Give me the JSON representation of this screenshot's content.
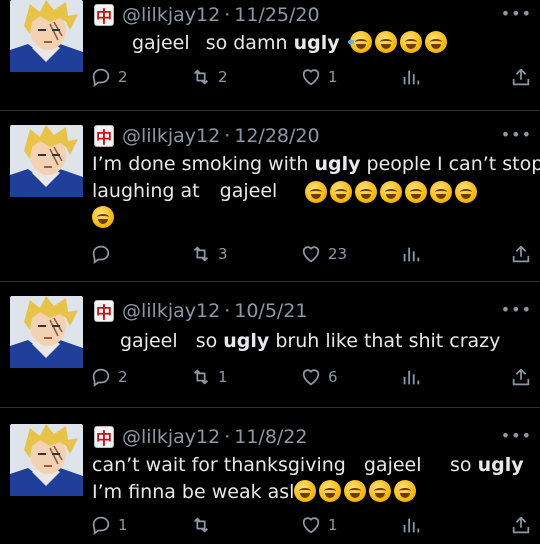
{
  "tweets": [
    {
      "handle": "@lilkjay12",
      "separator": "·",
      "date": "11/25/20",
      "more": "•••",
      "lines": [
        {
          "parts": [
            "gajeel",
            "so damn",
            "ugly"
          ],
          "emoji_count": 4
        }
      ],
      "replies": "2",
      "retweets": "2",
      "likes": "1"
    },
    {
      "handle": "@lilkjay12",
      "separator": "·",
      "date": "12/28/20",
      "more": "•••",
      "line1_pre": "I’m done smoking with ",
      "line1_bold": "ugly",
      "line1_post": " people I can’t stop",
      "line2": "laughing at",
      "line2_name": "gajeel",
      "emoji_row1": 7,
      "emoji_row2": 1,
      "replies": "",
      "retweets": "3",
      "likes": "23"
    },
    {
      "handle": "@lilkjay12",
      "separator": "·",
      "date": "10/5/21",
      "more": "•••",
      "name": "gajeel",
      "pre": "so ",
      "bold": "ugly",
      "post": " bruh like that shit crazy",
      "replies": "2",
      "retweets": "1",
      "likes": "6"
    },
    {
      "handle": "@lilkjay12",
      "separator": "·",
      "date": "11/8/22",
      "more": "•••",
      "line1": "can’t wait for thanksgiving",
      "name": "gajeel",
      "so": "so",
      "bold": "ugly",
      "line2": "I’m finna be weak asl",
      "emoji_count": 5,
      "replies": "1",
      "retweets": "",
      "likes": "1"
    }
  ],
  "mahjong_glyph": "中",
  "icons": [
    "reply-icon",
    "retweet-icon",
    "like-icon",
    "views-icon",
    "share-icon"
  ],
  "colors": {
    "background": "#000000",
    "text": "#e7e9ea",
    "muted": "#8b98a5",
    "divider": "#2f3336"
  }
}
